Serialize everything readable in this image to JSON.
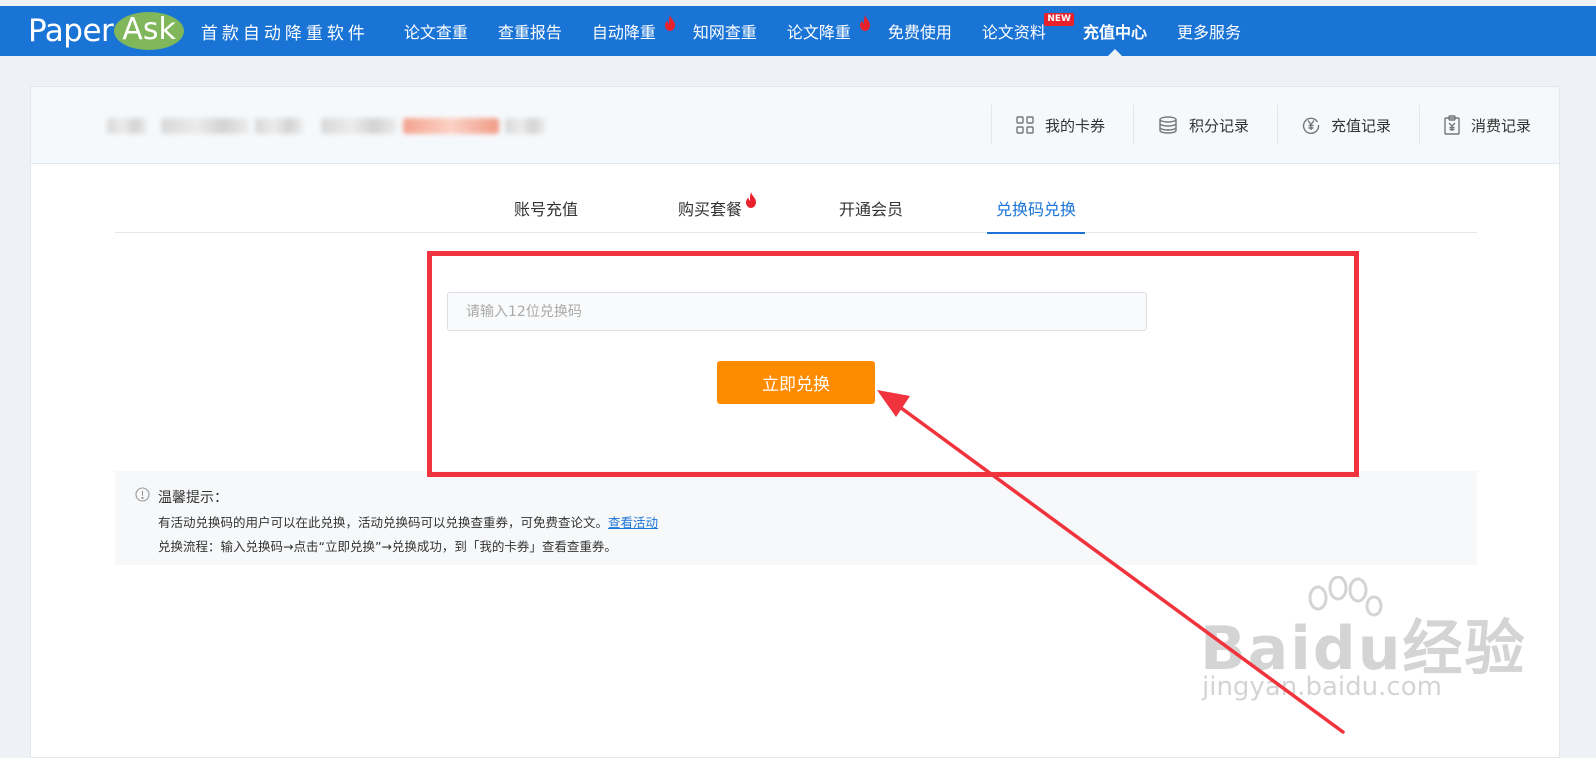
{
  "brand": {
    "paper": "Paper",
    "ask": "Ask",
    "slogan": "首款自动降重软件"
  },
  "nav": {
    "items": [
      {
        "label": "论文查重"
      },
      {
        "label": "查重报告"
      },
      {
        "label": "自动降重"
      },
      {
        "label": "知网查重"
      },
      {
        "label": "论文降重"
      },
      {
        "label": "免费使用"
      },
      {
        "label": "论文资料"
      },
      {
        "label": "充值中心"
      },
      {
        "label": "更多服务"
      }
    ],
    "new_badge": "NEW"
  },
  "account_links": [
    {
      "label": "我的卡券",
      "icon": "grid-icon"
    },
    {
      "label": "积分记录",
      "icon": "coins-stack-icon"
    },
    {
      "label": "充值记录",
      "icon": "yuan-icon"
    },
    {
      "label": "消费记录",
      "icon": "clipboard-yuan-icon"
    }
  ],
  "tabs": [
    {
      "label": "账号充值"
    },
    {
      "label": "购买套餐"
    },
    {
      "label": "开通会员"
    },
    {
      "label": "兑换码兑换"
    }
  ],
  "redeem": {
    "placeholder": "请输入12位兑换码",
    "button": "立即兑换"
  },
  "tips": {
    "title": "温馨提示：",
    "line1": "有活动兑换码的用户可以在此兑换，活动兑换码可以兑换查重券，可免费查论文。",
    "line1_link": "查看活动",
    "line2": "兑换流程：输入兑换码→点击“立即兑换”→兑换成功，到「我的卡券」查看查重券。"
  },
  "watermark": {
    "main": "Baidu经验",
    "sub": "jingyan.baidu.com"
  },
  "colors": {
    "nav_bg": "#1a74d6",
    "accent": "#1a74d6",
    "button": "#ff8c00",
    "annotation": "#f0333c",
    "fire": "#e8212b"
  }
}
